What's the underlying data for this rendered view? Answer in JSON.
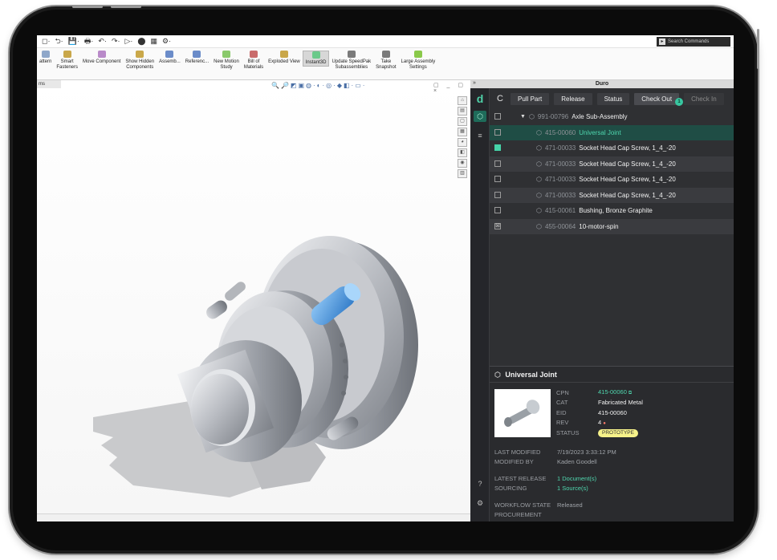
{
  "quick_access": {
    "icons": [
      "◻·",
      "⮌·",
      "💾·",
      "🖶·",
      "↶·",
      "↷·",
      "▷·",
      "⬤",
      "▦",
      "⚙·"
    ],
    "search_placeholder": "Search Commands"
  },
  "ribbon": {
    "buttons": [
      {
        "label": "attern",
        "sub": "",
        "color": "#8fa7c9"
      },
      {
        "label": "Smart",
        "sub": "Fasteners",
        "color": "#c9a74a"
      },
      {
        "label": "Move Component",
        "sub": "",
        "color": "#b98ac9"
      },
      {
        "label": "Show Hidden",
        "sub": "Components",
        "color": "#caa84a"
      },
      {
        "label": "Assemb...",
        "sub": "",
        "color": "#6b8cc9"
      },
      {
        "label": "Referenc...",
        "sub": "",
        "color": "#6b8cc9"
      },
      {
        "label": "New Motion",
        "sub": "Study",
        "color": "#8ac96b"
      },
      {
        "label": "Bill of",
        "sub": "Materials",
        "color": "#c96b6b"
      },
      {
        "label": "Exploded View",
        "sub": "",
        "color": "#c9a74a"
      },
      {
        "label": "Instant3D",
        "sub": "",
        "color": "#6bc98a"
      },
      {
        "label": "Update SpeedPak",
        "sub": "Subassemblies",
        "color": "#7a7a7a"
      },
      {
        "label": "Take",
        "sub": "Snapshot",
        "color": "#7a7a7a"
      },
      {
        "label": "Large Assembly",
        "sub": "Settings",
        "color": "#8ac94a"
      }
    ]
  },
  "viewport": {
    "tab_label": "ms",
    "headsup_icons": "🔍🔎◩▣◍·◐·◎·◆◧·▭·",
    "window_controls": "▢ _ ▢ ×"
  },
  "taskpane_icons": [
    "⌂",
    "▤",
    "▢",
    "▦",
    "◕",
    "◧",
    "◉",
    "▥"
  ],
  "duro": {
    "title": "Duro",
    "collapse": "»",
    "rail_logo": "d",
    "toolbar": {
      "refresh": "C",
      "pull_part": "Pull Part",
      "release": "Release",
      "status": "Status",
      "check_out": "Check Out",
      "check_in": "Check In",
      "cursor_badge": "1"
    },
    "tree": [
      {
        "cpn": "991-00796",
        "name": "Axle Sub-Assembly",
        "root": true,
        "state": "empty",
        "style": ""
      },
      {
        "cpn": "415-00060",
        "name": "Universal Joint",
        "root": false,
        "state": "empty",
        "style": "selected"
      },
      {
        "cpn": "471-00033",
        "name": "Socket Head Cap Screw, 1_4_-20",
        "root": false,
        "state": "checked",
        "style": ""
      },
      {
        "cpn": "471-00033",
        "name": "Socket Head Cap Screw, 1_4_-20",
        "root": false,
        "state": "empty",
        "style": "alt"
      },
      {
        "cpn": "471-00033",
        "name": "Socket Head Cap Screw, 1_4_-20",
        "root": false,
        "state": "empty",
        "style": ""
      },
      {
        "cpn": "471-00033",
        "name": "Socket Head Cap Screw, 1_4_-20",
        "root": false,
        "state": "empty",
        "style": "alt"
      },
      {
        "cpn": "415-00061",
        "name": "Bushing, Bronze Graphite",
        "root": false,
        "state": "empty",
        "style": ""
      },
      {
        "cpn": "455-00064",
        "name": "10-motor-spin",
        "root": false,
        "state": "mixed",
        "style": "alt"
      }
    ],
    "details": {
      "title": "Universal Joint",
      "props": {
        "cpn_label": "CPN",
        "cpn": "415-00060",
        "cat_label": "CAT",
        "cat": "Fabricated Metal",
        "eid_label": "EID",
        "eid": "415-00060",
        "rev_label": "REV",
        "rev": "4",
        "status_label": "STATUS",
        "status": "PROTOTYPE"
      },
      "meta": {
        "last_modified_label": "LAST MODIFIED",
        "last_modified": "7/19/2023 3:33:12 PM",
        "modified_by_label": "MODIFIED BY",
        "modified_by": "Kaden Goodell",
        "latest_release_label": "LATEST RELEASE",
        "latest_release": "1 Document(s)",
        "sourcing_label": "SOURCING",
        "sourcing": "1 Source(s)",
        "workflow_label": "WORKFLOW STATE",
        "workflow": "Released",
        "procurement_label": "PROCUREMENT",
        "procurement": ""
      }
    }
  }
}
